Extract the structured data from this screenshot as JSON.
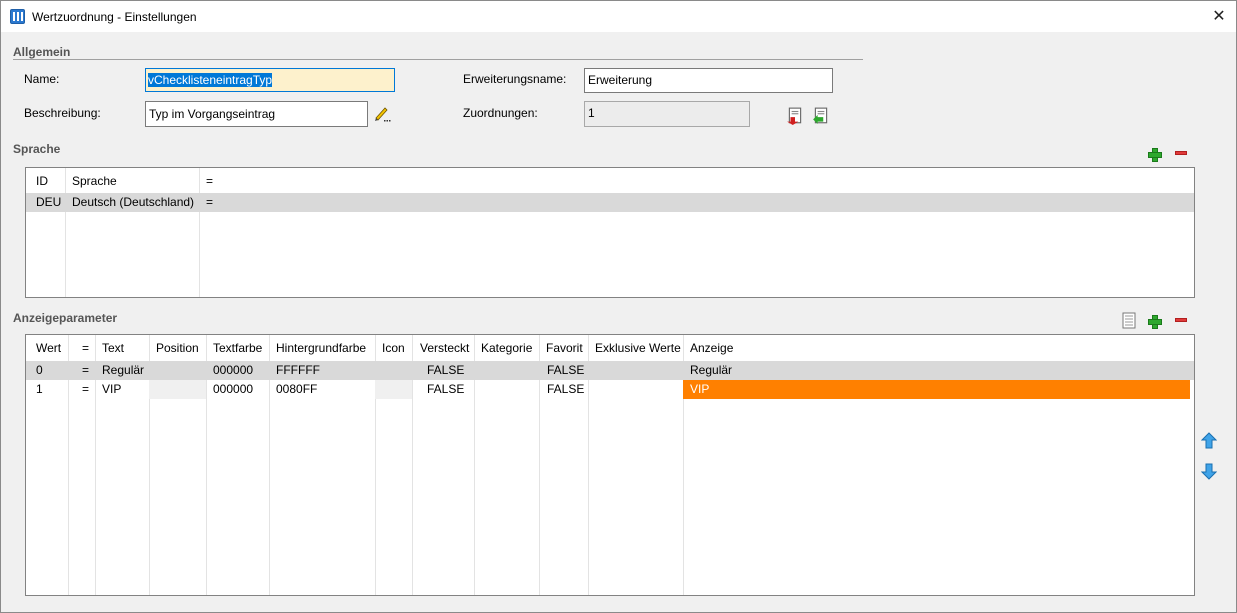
{
  "window": {
    "title": "Wertzuordnung - Einstellungen",
    "close_glyph": "✕"
  },
  "allgemein": {
    "section_title": "Allgemein",
    "name_label": "Name:",
    "name_value": "vChecklisteneintragTyp",
    "beschreibung_label": "Beschreibung:",
    "beschreibung_value": "Typ im Vorgangseintrag",
    "erweiterungsname_label": "Erweiterungsname:",
    "erweiterungsname_value": "Erweiterung",
    "zuordnungen_label": "Zuordnungen:",
    "zuordnungen_value": "1"
  },
  "sprache": {
    "section_title": "Sprache",
    "columns": [
      "ID",
      "Sprache",
      "="
    ],
    "rows": [
      [
        "DEU",
        "Deutsch (Deutschland)",
        "="
      ]
    ]
  },
  "anzeigeparameter": {
    "section_title": "Anzeigeparameter",
    "columns": [
      "Wert",
      "=",
      "Text",
      "Position",
      "Textfarbe",
      "Hintergrundfarbe",
      "Icon",
      "Versteckt",
      "Kategorie",
      "Favorit",
      "Exklusive Werte",
      "Anzeige"
    ],
    "rows": [
      [
        "0",
        "=",
        "Regulär",
        "",
        "000000",
        "FFFFFF",
        "",
        "FALSE",
        "",
        "FALSE",
        "",
        "Regulär"
      ],
      [
        "1",
        "=",
        "VIP",
        "",
        "000000",
        "0080FF",
        "",
        "FALSE",
        "",
        "FALSE",
        "",
        "VIP"
      ]
    ],
    "vip_preview_color": "#ff8000"
  },
  "icons": {
    "window": "window-app-icon",
    "edit": "pencil-icon",
    "export": "export-icon",
    "import": "import-icon",
    "add": "add-icon",
    "remove": "remove-icon",
    "list": "list-icon",
    "up": "arrow-up-icon",
    "down": "arrow-down-icon"
  },
  "colors": {
    "selection": "#0078d7",
    "name_field_bg": "#fdf1cc",
    "row_selected": "#d9d9d9",
    "row_alt": "#f0f0f0"
  }
}
